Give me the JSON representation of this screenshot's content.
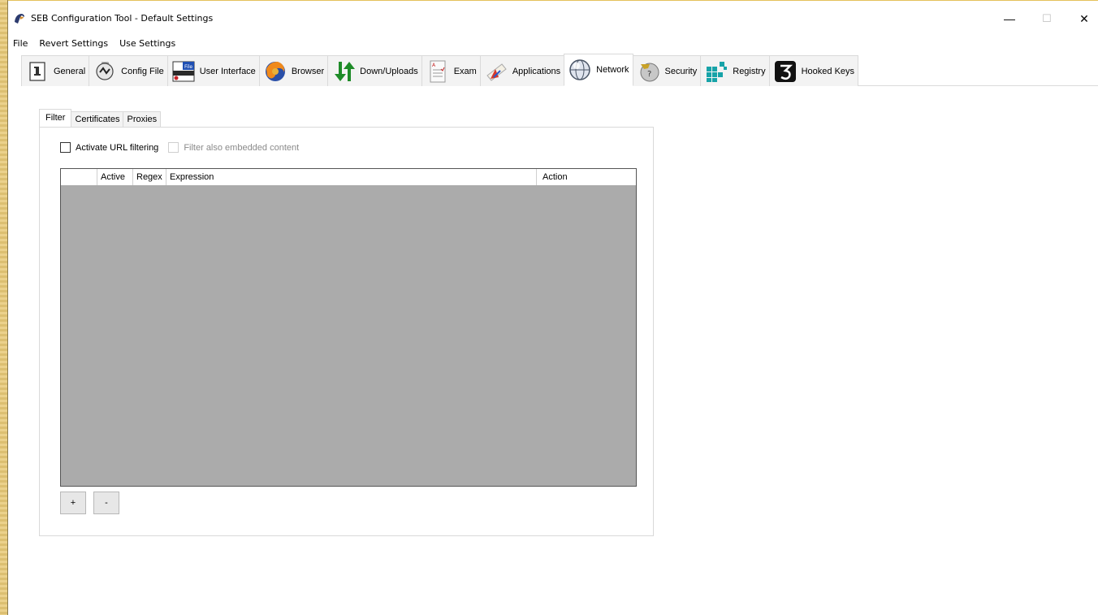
{
  "window": {
    "title": "SEB Configuration Tool - Default Settings",
    "controls": {
      "minimize": "—",
      "maximize": "☐",
      "close": "✕"
    }
  },
  "menu": [
    "File",
    "Revert Settings",
    "Use Settings"
  ],
  "toolbar_tabs": [
    {
      "label": "General",
      "icon": "general-icon"
    },
    {
      "label": "Config File",
      "icon": "config-file-icon"
    },
    {
      "label": "User Interface",
      "icon": "user-interface-icon"
    },
    {
      "label": "Browser",
      "icon": "browser-icon"
    },
    {
      "label": "Down/Uploads",
      "icon": "down-uploads-icon"
    },
    {
      "label": "Exam",
      "icon": "exam-icon"
    },
    {
      "label": "Applications",
      "icon": "applications-icon"
    },
    {
      "label": "Network",
      "icon": "network-icon",
      "active": true
    },
    {
      "label": "Security",
      "icon": "security-icon"
    },
    {
      "label": "Registry",
      "icon": "registry-icon"
    },
    {
      "label": "Hooked Keys",
      "icon": "hooked-keys-icon"
    }
  ],
  "subtabs": [
    "Filter",
    "Certificates",
    "Proxies"
  ],
  "filter": {
    "activate_url_filtering": "Activate URL filtering",
    "filter_embedded": "Filter also embedded content",
    "columns": [
      "Active",
      "Regex",
      "Expression",
      "Action"
    ],
    "add_button": "+",
    "remove_button": "-"
  },
  "colors": {
    "grid_background": "#ababab",
    "tab_inactive": "#f3f3f3",
    "desktop_strip": "#e8c977"
  }
}
